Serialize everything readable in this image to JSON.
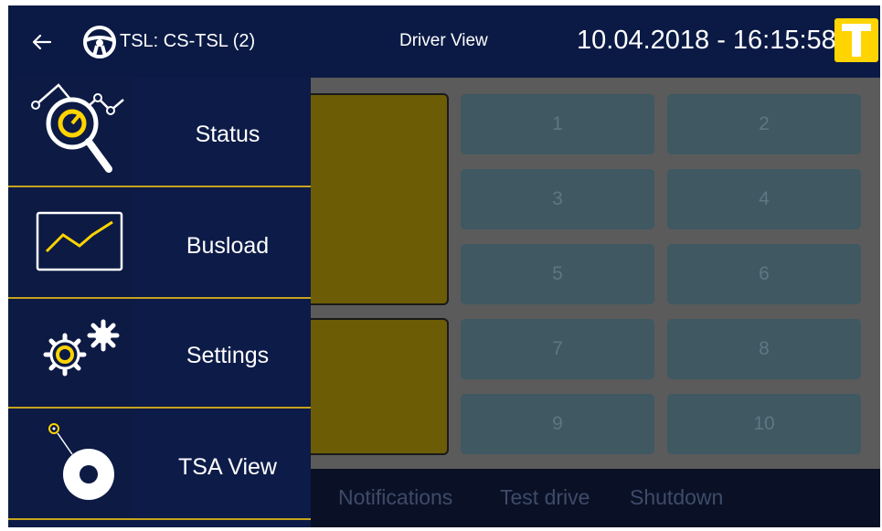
{
  "header": {
    "tsl_label": "TSL: CS-TSL (2)",
    "view_label": "Driver View",
    "datetime": "10.04.2018 - 16:15:58",
    "logo_letter": "T"
  },
  "drawer": {
    "items": [
      {
        "label": "Status",
        "icon": "status-magnifier-icon"
      },
      {
        "label": "Busload",
        "icon": "busload-chart-icon"
      },
      {
        "label": "Settings",
        "icon": "settings-gears-icon"
      },
      {
        "label": "TSA View",
        "icon": "tsa-view-icon"
      }
    ]
  },
  "main": {
    "tiles": [
      "1",
      "2",
      "3",
      "4",
      "5",
      "6",
      "7",
      "8",
      "9",
      "10"
    ]
  },
  "bottom": {
    "notifications": "Notifications",
    "test_drive": "Test drive",
    "shutdown": "Shutdown"
  },
  "colors": {
    "accent_yellow": "#ffd400",
    "header_bg": "#0b1a45",
    "drawer_bg": "#0d1b48",
    "divider": "#c6a31c"
  }
}
